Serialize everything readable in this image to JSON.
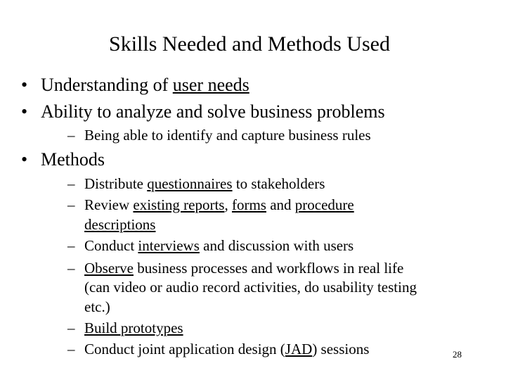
{
  "slide": {
    "title": "Skills Needed and Methods Used",
    "bullet_char": "•",
    "dash_char": "–",
    "items": [
      {
        "parts": [
          {
            "t": "Understanding of "
          },
          {
            "t": "user needs",
            "u": true
          }
        ]
      },
      {
        "parts": [
          {
            "t": "Ability to analyze and solve business problems"
          }
        ]
      },
      {
        "parts": [
          {
            "t": "Being able to identify and capture business rules"
          }
        ]
      },
      {
        "parts": [
          {
            "t": "Methods"
          }
        ]
      },
      {
        "parts": [
          {
            "t": "Distribute "
          },
          {
            "t": "questionnaires",
            "u": true
          },
          {
            "t": " to stakeholders"
          }
        ]
      },
      {
        "parts": [
          {
            "t": "Review "
          },
          {
            "t": "existing reports",
            "u": true
          },
          {
            "t": ", "
          },
          {
            "t": "forms",
            "u": true
          },
          {
            "t": " and "
          },
          {
            "t": "procedure",
            "u": true
          }
        ]
      },
      {
        "parts": [
          {
            "t": "descriptions",
            "u": true
          }
        ]
      },
      {
        "parts": [
          {
            "t": "Conduct "
          },
          {
            "t": "interviews",
            "u": true
          },
          {
            "t": " and discussion with users"
          }
        ]
      },
      {
        "parts": [
          {
            "t": "Observe",
            "u": true
          },
          {
            "t": " business processes and workflows in real life"
          }
        ]
      },
      {
        "parts": [
          {
            "t": "(can video or audio record activities, do usability testing"
          }
        ]
      },
      {
        "parts": [
          {
            "t": "etc.)"
          }
        ]
      },
      {
        "parts": [
          {
            "t": "Build prototypes",
            "u": true
          }
        ]
      },
      {
        "parts": [
          {
            "t": "Conduct joint application design ("
          },
          {
            "t": "JAD",
            "u": true
          },
          {
            "t": ") sessions"
          }
        ]
      }
    ],
    "page_number": "28"
  }
}
